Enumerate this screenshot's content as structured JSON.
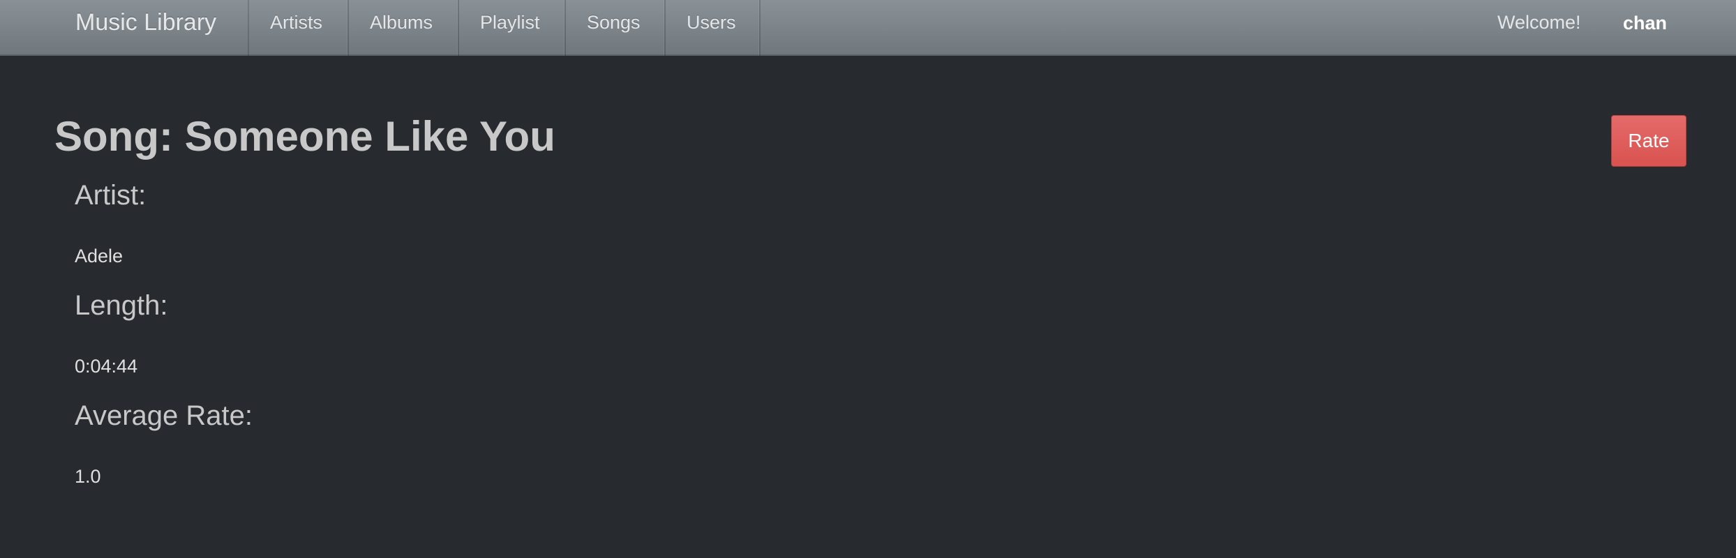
{
  "navbar": {
    "brand": "Music Library",
    "items": [
      {
        "label": "Artists"
      },
      {
        "label": "Albums"
      },
      {
        "label": "Playlist"
      },
      {
        "label": "Songs"
      },
      {
        "label": "Users"
      }
    ],
    "welcome": "Welcome!",
    "username": "chan"
  },
  "song": {
    "title": "Song: Someone Like You",
    "rate_button": "Rate",
    "artist_label": "Artist:",
    "artist_value": "Adele",
    "length_label": "Length:",
    "length_value": "0:04:44",
    "average_rate_label": "Average Rate:",
    "average_rate_value": "1.0"
  },
  "colors": {
    "background": "#272b30",
    "navbar": "#7a8288",
    "rate_button": "#d9534f",
    "heading_text": "#c8c8c8"
  }
}
